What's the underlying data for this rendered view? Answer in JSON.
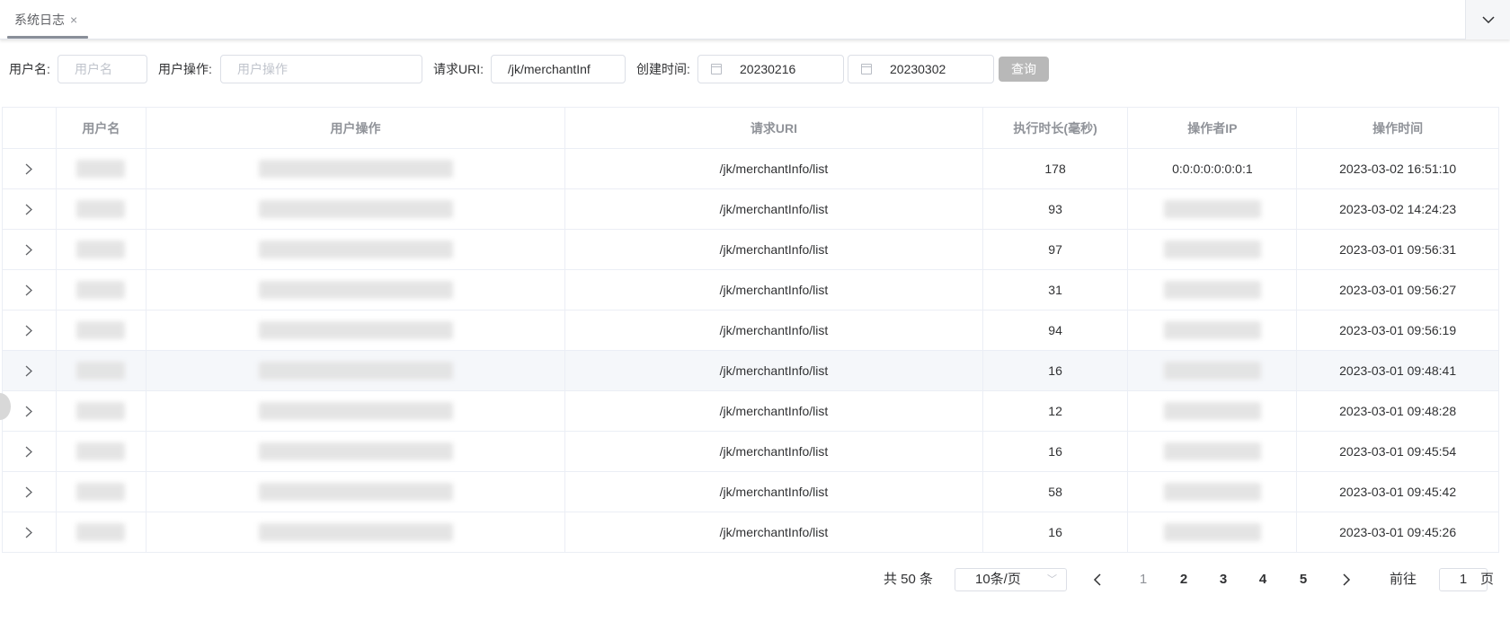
{
  "tabs": [
    {
      "label": "系统日志",
      "close": "×"
    }
  ],
  "filters": {
    "username_label": "用户名:",
    "username_placeholder": "用户名",
    "operation_label": "用户操作:",
    "operation_placeholder": "用户操作",
    "uri_label": "请求URI:",
    "uri_value": "/jk/merchantInf",
    "created_label": "创建时间:",
    "start_date": "20230216",
    "end_date": "20230302",
    "query_button": "查询"
  },
  "table": {
    "headers": [
      "",
      "用户名",
      "用户操作",
      "请求URI",
      "执行时长(毫秒)",
      "操作者IP",
      "操作时间"
    ],
    "rows": [
      {
        "uri": "/jk/merchantInfo/list",
        "duration": "178",
        "ip": "0:0:0:0:0:0:0:1",
        "time": "2023-03-02 16:51:10"
      },
      {
        "uri": "/jk/merchantInfo/list",
        "duration": "93",
        "ip": "",
        "time": "2023-03-02 14:24:23"
      },
      {
        "uri": "/jk/merchantInfo/list",
        "duration": "97",
        "ip": "",
        "time": "2023-03-01 09:56:31"
      },
      {
        "uri": "/jk/merchantInfo/list",
        "duration": "31",
        "ip": "",
        "time": "2023-03-01 09:56:27"
      },
      {
        "uri": "/jk/merchantInfo/list",
        "duration": "94",
        "ip": "",
        "time": "2023-03-01 09:56:19"
      },
      {
        "uri": "/jk/merchantInfo/list",
        "duration": "16",
        "ip": "",
        "time": "2023-03-01 09:48:41"
      },
      {
        "uri": "/jk/merchantInfo/list",
        "duration": "12",
        "ip": "",
        "time": "2023-03-01 09:48:28"
      },
      {
        "uri": "/jk/merchantInfo/list",
        "duration": "16",
        "ip": "",
        "time": "2023-03-01 09:45:54"
      },
      {
        "uri": "/jk/merchantInfo/list",
        "duration": "58",
        "ip": "",
        "time": "2023-03-01 09:45:42"
      },
      {
        "uri": "/jk/merchantInfo/list",
        "duration": "16",
        "ip": "",
        "time": "2023-03-01 09:45:26"
      }
    ]
  },
  "pagination": {
    "total": "共 50 条",
    "page_size": "10条/页",
    "pages": [
      "1",
      "2",
      "3",
      "4",
      "5"
    ],
    "current_page": "1",
    "goto_label": "前往",
    "goto_value": "1",
    "page_suffix": "页"
  },
  "icons": {
    "tab_dropdown": "chevron-down-icon",
    "expand": "chevron-right-icon",
    "date": "calendar-icon",
    "prev": "chevron-left-icon",
    "next": "chevron-right-icon"
  }
}
